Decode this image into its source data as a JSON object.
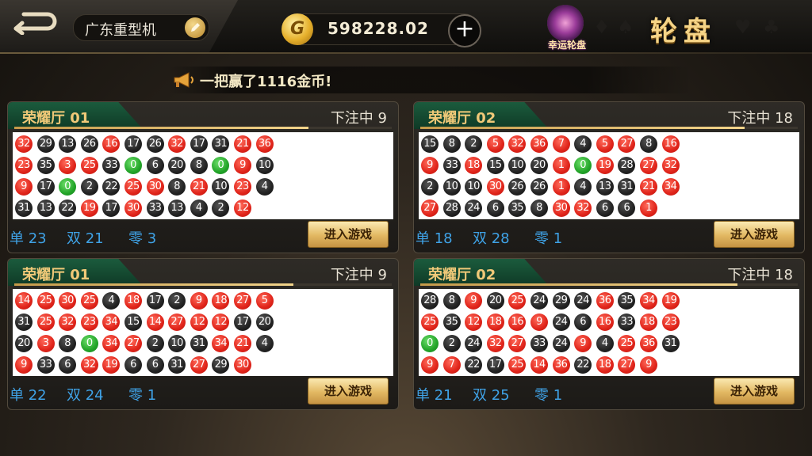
{
  "header": {
    "username": "广东重型机",
    "coins": "598228.02",
    "lucky_label": "幸运轮盘",
    "game_title": "轮盘",
    "coin_glyph": "G"
  },
  "notice": {
    "text": "一把赢了1116金币!"
  },
  "panels": [
    {
      "hall": "荣耀厅 01",
      "status": "下注中 9",
      "progress": 0.78,
      "stats": {
        "odd": "单 23",
        "even": "双 21",
        "zero": "零 3"
      },
      "enter": "进入游戏",
      "rows": [
        [
          [
            32,
            "r"
          ],
          [
            29,
            "b"
          ],
          [
            13,
            "b"
          ],
          [
            26,
            "b"
          ],
          [
            16,
            "r"
          ],
          [
            17,
            "b"
          ],
          [
            26,
            "b"
          ],
          [
            32,
            "r"
          ],
          [
            17,
            "b"
          ],
          [
            31,
            "b"
          ],
          [
            21,
            "r"
          ],
          [
            36,
            "r"
          ]
        ],
        [
          [
            23,
            "r"
          ],
          [
            35,
            "b"
          ],
          [
            3,
            "r"
          ],
          [
            25,
            "r"
          ],
          [
            33,
            "b"
          ],
          [
            0,
            "g"
          ],
          [
            6,
            "b"
          ],
          [
            20,
            "b"
          ],
          [
            8,
            "b"
          ],
          [
            0,
            "g"
          ],
          [
            9,
            "r"
          ],
          [
            10,
            "b"
          ]
        ],
        [
          [
            9,
            "r"
          ],
          [
            17,
            "b"
          ],
          [
            0,
            "g"
          ],
          [
            2,
            "b"
          ],
          [
            22,
            "b"
          ],
          [
            25,
            "r"
          ],
          [
            30,
            "r"
          ],
          [
            8,
            "b"
          ],
          [
            21,
            "r"
          ],
          [
            10,
            "b"
          ],
          [
            23,
            "r"
          ],
          [
            4,
            "b"
          ]
        ],
        [
          [
            31,
            "b"
          ],
          [
            13,
            "b"
          ],
          [
            22,
            "b"
          ],
          [
            19,
            "r"
          ],
          [
            17,
            "b"
          ],
          [
            30,
            "r"
          ],
          [
            33,
            "b"
          ],
          [
            13,
            "b"
          ],
          [
            4,
            "b"
          ],
          [
            2,
            "b"
          ],
          [
            12,
            "r"
          ]
        ]
      ]
    },
    {
      "hall": "荣耀厅 02",
      "status": "下注中 18",
      "progress": 0.86,
      "stats": {
        "odd": "单 18",
        "even": "双 28",
        "zero": "零 1"
      },
      "enter": "进入游戏",
      "rows": [
        [
          [
            15,
            "b"
          ],
          [
            8,
            "b"
          ],
          [
            2,
            "b"
          ],
          [
            5,
            "r"
          ],
          [
            32,
            "r"
          ],
          [
            36,
            "r"
          ],
          [
            7,
            "r"
          ],
          [
            4,
            "b"
          ],
          [
            5,
            "r"
          ],
          [
            27,
            "r"
          ],
          [
            8,
            "b"
          ],
          [
            16,
            "r"
          ]
        ],
        [
          [
            9,
            "r"
          ],
          [
            33,
            "b"
          ],
          [
            18,
            "r"
          ],
          [
            15,
            "b"
          ],
          [
            10,
            "b"
          ],
          [
            20,
            "b"
          ],
          [
            1,
            "r"
          ],
          [
            0,
            "g"
          ],
          [
            19,
            "r"
          ],
          [
            28,
            "b"
          ],
          [
            27,
            "r"
          ],
          [
            32,
            "r"
          ]
        ],
        [
          [
            2,
            "b"
          ],
          [
            10,
            "b"
          ],
          [
            10,
            "b"
          ],
          [
            30,
            "r"
          ],
          [
            26,
            "b"
          ],
          [
            26,
            "b"
          ],
          [
            1,
            "r"
          ],
          [
            4,
            "b"
          ],
          [
            13,
            "b"
          ],
          [
            31,
            "b"
          ],
          [
            21,
            "r"
          ],
          [
            34,
            "r"
          ]
        ],
        [
          [
            27,
            "r"
          ],
          [
            28,
            "b"
          ],
          [
            24,
            "b"
          ],
          [
            6,
            "b"
          ],
          [
            35,
            "b"
          ],
          [
            8,
            "b"
          ],
          [
            30,
            "r"
          ],
          [
            32,
            "r"
          ],
          [
            6,
            "b"
          ],
          [
            6,
            "b"
          ],
          [
            1,
            "r"
          ]
        ]
      ]
    },
    {
      "hall": "荣耀厅 01",
      "status": "下注中 9",
      "progress": 0.74,
      "stats": {
        "odd": "单 22",
        "even": "双 24",
        "zero": "零 1"
      },
      "enter": "进入游戏",
      "rows": [
        [
          [
            14,
            "r"
          ],
          [
            25,
            "r"
          ],
          [
            30,
            "r"
          ],
          [
            25,
            "r"
          ],
          [
            4,
            "b"
          ],
          [
            18,
            "r"
          ],
          [
            17,
            "b"
          ],
          [
            2,
            "b"
          ],
          [
            9,
            "r"
          ],
          [
            18,
            "r"
          ],
          [
            27,
            "r"
          ],
          [
            5,
            "r"
          ]
        ],
        [
          [
            31,
            "b"
          ],
          [
            25,
            "r"
          ],
          [
            32,
            "r"
          ],
          [
            23,
            "r"
          ],
          [
            34,
            "r"
          ],
          [
            15,
            "b"
          ],
          [
            14,
            "r"
          ],
          [
            27,
            "r"
          ],
          [
            12,
            "r"
          ],
          [
            12,
            "r"
          ],
          [
            17,
            "b"
          ],
          [
            20,
            "b"
          ]
        ],
        [
          [
            20,
            "b"
          ],
          [
            3,
            "r"
          ],
          [
            8,
            "b"
          ],
          [
            0,
            "g"
          ],
          [
            34,
            "r"
          ],
          [
            27,
            "r"
          ],
          [
            2,
            "b"
          ],
          [
            10,
            "b"
          ],
          [
            31,
            "b"
          ],
          [
            34,
            "r"
          ],
          [
            21,
            "r"
          ],
          [
            4,
            "b"
          ]
        ],
        [
          [
            9,
            "r"
          ],
          [
            33,
            "b"
          ],
          [
            6,
            "b"
          ],
          [
            32,
            "r"
          ],
          [
            19,
            "r"
          ],
          [
            6,
            "b"
          ],
          [
            6,
            "b"
          ],
          [
            31,
            "b"
          ],
          [
            27,
            "r"
          ],
          [
            29,
            "b"
          ],
          [
            30,
            "r"
          ]
        ]
      ]
    },
    {
      "hall": "荣耀厅 02",
      "status": "下注中 18",
      "progress": 0.84,
      "stats": {
        "odd": "单 21",
        "even": "双 25",
        "zero": "零 1"
      },
      "enter": "进入游戏",
      "rows": [
        [
          [
            28,
            "b"
          ],
          [
            8,
            "b"
          ],
          [
            9,
            "r"
          ],
          [
            20,
            "b"
          ],
          [
            25,
            "r"
          ],
          [
            24,
            "b"
          ],
          [
            29,
            "b"
          ],
          [
            24,
            "b"
          ],
          [
            36,
            "r"
          ],
          [
            35,
            "b"
          ],
          [
            34,
            "r"
          ],
          [
            19,
            "r"
          ]
        ],
        [
          [
            25,
            "r"
          ],
          [
            35,
            "b"
          ],
          [
            12,
            "r"
          ],
          [
            18,
            "r"
          ],
          [
            16,
            "r"
          ],
          [
            9,
            "r"
          ],
          [
            24,
            "b"
          ],
          [
            6,
            "b"
          ],
          [
            16,
            "r"
          ],
          [
            33,
            "b"
          ],
          [
            18,
            "r"
          ],
          [
            23,
            "r"
          ]
        ],
        [
          [
            0,
            "g"
          ],
          [
            2,
            "b"
          ],
          [
            24,
            "b"
          ],
          [
            32,
            "r"
          ],
          [
            27,
            "r"
          ],
          [
            33,
            "b"
          ],
          [
            24,
            "b"
          ],
          [
            9,
            "r"
          ],
          [
            4,
            "b"
          ],
          [
            25,
            "r"
          ],
          [
            36,
            "r"
          ],
          [
            31,
            "b"
          ]
        ],
        [
          [
            9,
            "r"
          ],
          [
            7,
            "r"
          ],
          [
            22,
            "b"
          ],
          [
            17,
            "b"
          ],
          [
            25,
            "r"
          ],
          [
            14,
            "r"
          ],
          [
            36,
            "r"
          ],
          [
            22,
            "b"
          ],
          [
            18,
            "r"
          ],
          [
            27,
            "r"
          ],
          [
            9,
            "r"
          ]
        ]
      ]
    }
  ]
}
